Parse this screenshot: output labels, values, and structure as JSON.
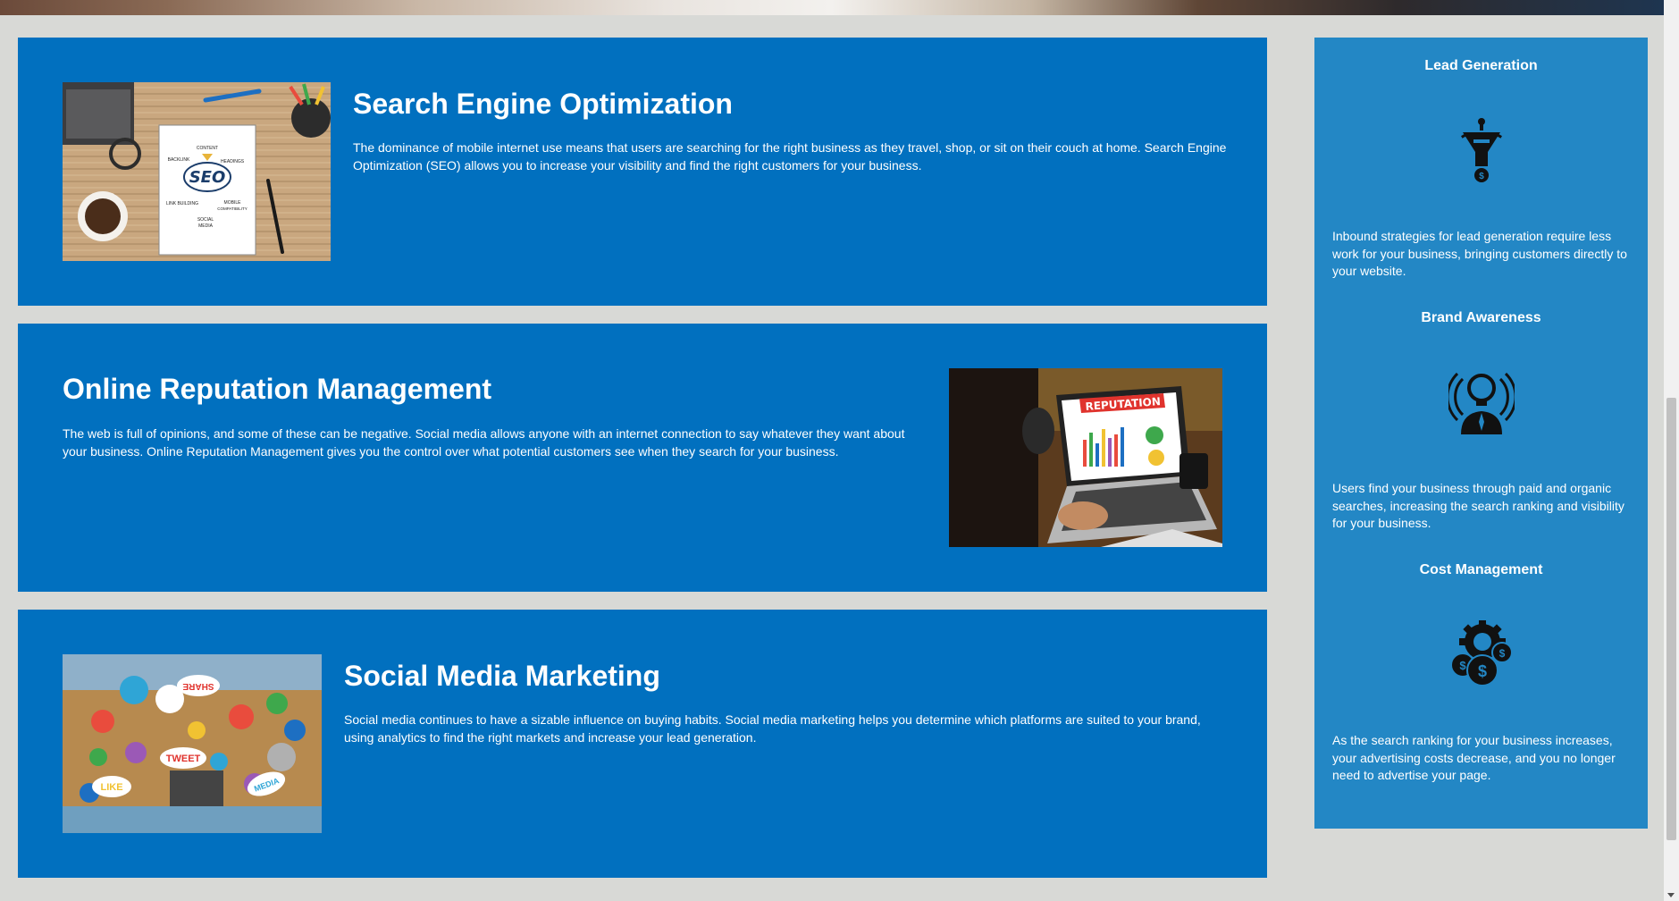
{
  "services": [
    {
      "title": "Search Engine Optimization",
      "body": "The dominance of mobile internet use means that users are searching for the right business as they travel, shop, or sit on their couch at home. Search Engine Optimization (SEO) allows you to increase your visibility and find the right customers for your business.",
      "image_text": {
        "center": "SEO",
        "content": "CONTENT",
        "backlink": "BACKLINK",
        "headings": "HEADINGS",
        "link_building": "LINK BUILDING",
        "mobile": "MOBILE",
        "compatibility": "COMPATIBILITY",
        "social": "SOCIAL",
        "media": "MEDIA"
      }
    },
    {
      "title": "Online Reputation Management",
      "body": "The web is full of opinions, and some of these can be negative. Social media allows anyone with an internet connection to say whatever they want about your business. Online Reputation Management gives you the control over what potential customers see when they search for your business.",
      "image_text": {
        "banner": "REPUTATION"
      }
    },
    {
      "title": "Social Media Marketing",
      "body": "Social media continues to have a sizable influence on buying habits. Social media marketing helps you determine which platforms are suited to your brand, using analytics to find the right markets and increase your lead generation.",
      "image_text": {
        "share": "SHARE",
        "tweet": "TWEET",
        "like": "LIKE",
        "media": "MEDIA"
      }
    }
  ],
  "benefits": [
    {
      "title": "Lead Generation",
      "icon": "funnel-dollar-icon",
      "body": "Inbound strategies for lead generation require less work for your business, bringing customers directly to your website."
    },
    {
      "title": "Brand Awareness",
      "icon": "lightbulb-person-broadcast-icon",
      "body": "Users find your business through paid and organic searches, increasing the search ranking and visibility for your business."
    },
    {
      "title": "Cost Management",
      "icon": "gear-coins-icon",
      "body": "As the search ranking for your business increases, your advertising costs decrease, and you no longer need to advertise your page."
    }
  ],
  "colors": {
    "card_blue": "#0170bf",
    "aside_blue": "#2387c5",
    "page_bg": "#d8d9d6"
  }
}
